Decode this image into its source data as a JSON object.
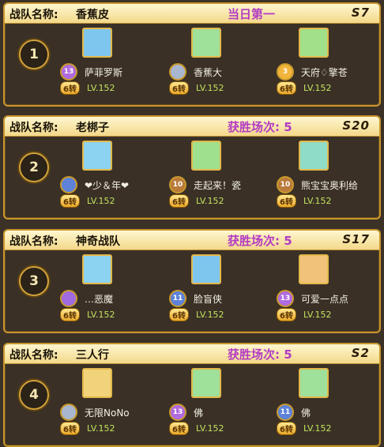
{
  "team_label": "战队名称:",
  "teams": [
    {
      "rank": "1",
      "name": "香蕉皮",
      "status": "当日第一",
      "server": "S7",
      "members": [
        {
          "name": "萨菲罗斯",
          "badge": "13",
          "badge_color": "#b06be0",
          "turn": "6转",
          "level": "LV.152",
          "avatar_color": "#7fc6ef"
        },
        {
          "name": "香蕉大",
          "badge": "",
          "badge_color": "#a9b6cf",
          "turn": "6转",
          "level": "LV.152",
          "avatar_color": "#9fe09a"
        },
        {
          "name": "天府♢擎苍",
          "badge": "3",
          "badge_color": "#f2b43a",
          "turn": "6转",
          "level": "LV.152",
          "avatar_color": "#a3e08a"
        }
      ]
    },
    {
      "rank": "2",
      "name": "老梆子",
      "status": "获胜场次: 5",
      "server": "S20",
      "members": [
        {
          "name": "❤少＆年❤",
          "badge": "",
          "badge_color": "#5d82d8",
          "turn": "6转",
          "level": "LV.152",
          "avatar_color": "#8bd3f0"
        },
        {
          "name": "走起来！瓷",
          "badge": "10",
          "badge_color": "#b97a3a",
          "turn": "6转",
          "level": "LV.152",
          "avatar_color": "#9fe08e"
        },
        {
          "name": "熊宝宝奥利给",
          "badge": "10",
          "badge_color": "#b97a3a",
          "turn": "6转",
          "level": "LV.152",
          "avatar_color": "#8fdcc9"
        }
      ]
    },
    {
      "rank": "3",
      "name": "神奇战队",
      "status": "获胜场次: 5",
      "server": "S17",
      "members": [
        {
          "name": "…恶魔",
          "badge": "",
          "badge_color": "#a06be0",
          "turn": "6转",
          "level": "LV.152",
          "avatar_color": "#8bd3f0"
        },
        {
          "name": "脸盲侠",
          "badge": "11",
          "badge_color": "#5d82d8",
          "turn": "6转",
          "level": "LV.152",
          "avatar_color": "#7fc6ef"
        },
        {
          "name": "可爱一点点",
          "badge": "13",
          "badge_color": "#b06be0",
          "turn": "6转",
          "level": "LV.152",
          "avatar_color": "#f1c27a"
        }
      ]
    },
    {
      "rank": "4",
      "name": "三人行",
      "status": "获胜场次: 5",
      "server": "S2",
      "members": [
        {
          "name": "无限NoNo",
          "badge": "",
          "badge_color": "#a9b6cf",
          "turn": "6转",
          "level": "LV.152",
          "avatar_color": "#f1d37a"
        },
        {
          "name": "佛",
          "badge": "13",
          "badge_color": "#b06be0",
          "turn": "6转",
          "level": "LV.152",
          "avatar_color": "#9fe09a"
        },
        {
          "name": "佛",
          "badge": "11",
          "badge_color": "#5d82d8",
          "turn": "6转",
          "level": "LV.152",
          "avatar_color": "#9fe09a"
        }
      ]
    }
  ]
}
